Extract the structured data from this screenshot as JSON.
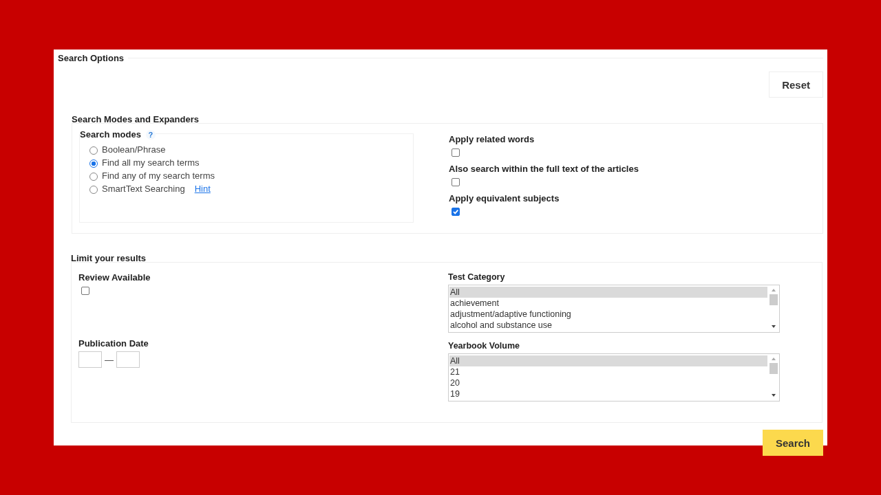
{
  "title": "Search Options",
  "reset_button": "Reset",
  "modes_section": {
    "legend": "Search Modes and Expanders",
    "search_modes": {
      "label": "Search modes",
      "help": "?",
      "options": [
        {
          "label": "Boolean/Phrase",
          "selected": false
        },
        {
          "label": "Find all my search terms",
          "selected": true
        },
        {
          "label": "Find any of my search terms",
          "selected": false
        },
        {
          "label": "SmartText Searching",
          "selected": false,
          "link": "Hint"
        }
      ]
    },
    "expanders": [
      {
        "label": "Apply related words",
        "checked": false
      },
      {
        "label": "Also search within the full text of the articles",
        "checked": false
      },
      {
        "label": "Apply equivalent subjects",
        "checked": true
      }
    ]
  },
  "limit_section": {
    "legend": "Limit your results",
    "review_available": {
      "label": "Review Available",
      "checked": false
    },
    "publication_date": {
      "label": "Publication Date",
      "separator": "—"
    },
    "lists": [
      {
        "label": "Test Category",
        "items": [
          {
            "label": "All",
            "selected": true
          },
          {
            "label": "achievement",
            "selected": false
          },
          {
            "label": "adjustment/adaptive functioning",
            "selected": false
          },
          {
            "label": "alcohol and substance use",
            "selected": false
          }
        ]
      },
      {
        "label": "Yearbook Volume",
        "items": [
          {
            "label": "All",
            "selected": true
          },
          {
            "label": "21",
            "selected": false
          },
          {
            "label": "20",
            "selected": false
          },
          {
            "label": "19",
            "selected": false
          }
        ]
      }
    ]
  },
  "search_button": "Search"
}
